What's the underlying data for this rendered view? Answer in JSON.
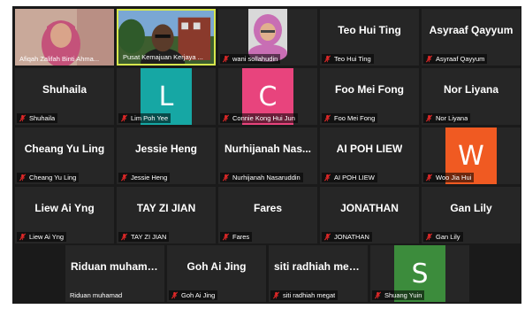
{
  "colors": {
    "tile_bg": "#262626",
    "active_speaker_border": "#d7e74d",
    "mic_muted": "#e02828"
  },
  "participants": [
    {
      "name": "Afiqah Zalifah Binti Ahma...",
      "display": "video",
      "muted": false
    },
    {
      "name": "Pusat Kemajuan Kerjaya ...",
      "display": "video",
      "muted": false,
      "active_speaker": true
    },
    {
      "name": "wani sollahudin",
      "display": "video",
      "muted": true
    },
    {
      "name": "Teo Hui Ting",
      "display": "name",
      "muted": true
    },
    {
      "name": "Asyraaf Qayyum",
      "display": "name",
      "muted": true
    },
    {
      "name": "Shuhaila",
      "display": "name",
      "muted": true
    },
    {
      "name": "Lim Poh Yee",
      "display": "avatar",
      "initial": "L",
      "avatar_color": "#16a7a4",
      "muted": true
    },
    {
      "name": "Connie Kong Hui Jun",
      "display": "avatar",
      "initial": "C",
      "avatar_color": "#e8447d",
      "muted": true
    },
    {
      "name": "Foo Mei Fong",
      "display": "name",
      "muted": true
    },
    {
      "name": "Nor Liyana",
      "display": "name",
      "muted": true
    },
    {
      "name": "Cheang Yu Ling",
      "display": "name",
      "muted": true
    },
    {
      "name": "Jessie Heng",
      "display": "name",
      "muted": true
    },
    {
      "name": "Nurhijanah Nasaruddin",
      "title": "Nurhijanah Nas...",
      "display": "name",
      "muted": true
    },
    {
      "name": "AI POH LIEW",
      "display": "name",
      "muted": true
    },
    {
      "name": "Woo Jia Hui",
      "display": "avatar",
      "initial": "W",
      "avatar_color": "#f05a22",
      "muted": true
    },
    {
      "name": "Liew Ai Yng",
      "display": "name",
      "muted": true
    },
    {
      "name": "TAY ZI JIAN",
      "display": "name",
      "muted": true
    },
    {
      "name": "Fares",
      "display": "name",
      "muted": true
    },
    {
      "name": "JONATHAN",
      "display": "name",
      "muted": true
    },
    {
      "name": "Gan Lily",
      "display": "name",
      "muted": true
    },
    {
      "name": "Riduan muhamad",
      "display": "name",
      "muted": false
    },
    {
      "name": "Goh Ai Jing",
      "display": "name",
      "muted": true
    },
    {
      "name": "siti radhiah megat",
      "title": "siti radhiah meg...",
      "display": "name",
      "muted": true
    },
    {
      "name": "Shuang Yuin",
      "display": "avatar",
      "initial": "S",
      "avatar_color": "#3c8c3c",
      "muted": true
    }
  ]
}
